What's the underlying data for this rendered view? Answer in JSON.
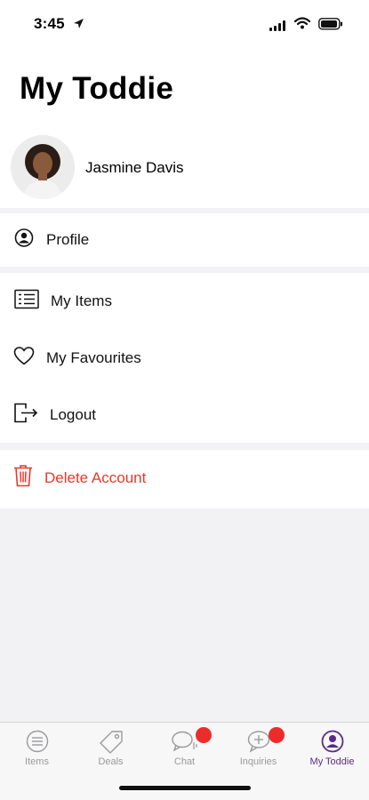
{
  "status_bar": {
    "time": "3:45"
  },
  "header": {
    "title": "My Toddie"
  },
  "user": {
    "name": "Jasmine Davis"
  },
  "menu": {
    "profile": "Profile",
    "my_items": "My Items",
    "my_favourites": "My Favourites",
    "logout": "Logout",
    "delete_account": "Delete Account"
  },
  "colors": {
    "accent": "#5b2a86",
    "danger": "#e8382c",
    "badge": "#ee2b2b"
  },
  "tabbar": {
    "tabs": [
      {
        "label": "Items",
        "icon": "list-circle-icon",
        "badge": false
      },
      {
        "label": "Deals",
        "icon": "tag-icon",
        "badge": false
      },
      {
        "label": "Chat",
        "icon": "chat-bubble-icon",
        "badge": true
      },
      {
        "label": "Inquiries",
        "icon": "plus-bubble-icon",
        "badge": true
      },
      {
        "label": "My Toddie",
        "icon": "person-circle-icon",
        "badge": false,
        "active": true
      }
    ]
  }
}
